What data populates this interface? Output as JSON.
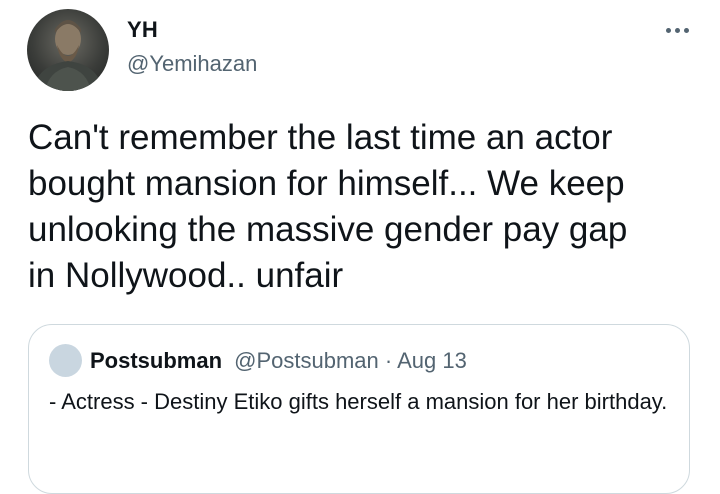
{
  "tweet": {
    "author": {
      "display_name": "YH",
      "handle": "@Yemihazan"
    },
    "text": "Can't remember the last time an actor\nbought mansion for himself... We keep\nunlooking the massive gender pay gap\nin Nollywood.. unfair",
    "more_icon": "more-horizontal-icon"
  },
  "quote": {
    "author": {
      "display_name": "Postsubman",
      "handle": "@Postsubman",
      "separator": " · ",
      "date": "Aug 13"
    },
    "text": "- Actress - Destiny Etiko gifts herself a mansion for her birthday."
  },
  "colors": {
    "primary_text": "#0f1419",
    "secondary_text": "#536471",
    "border": "#cfd9de"
  }
}
